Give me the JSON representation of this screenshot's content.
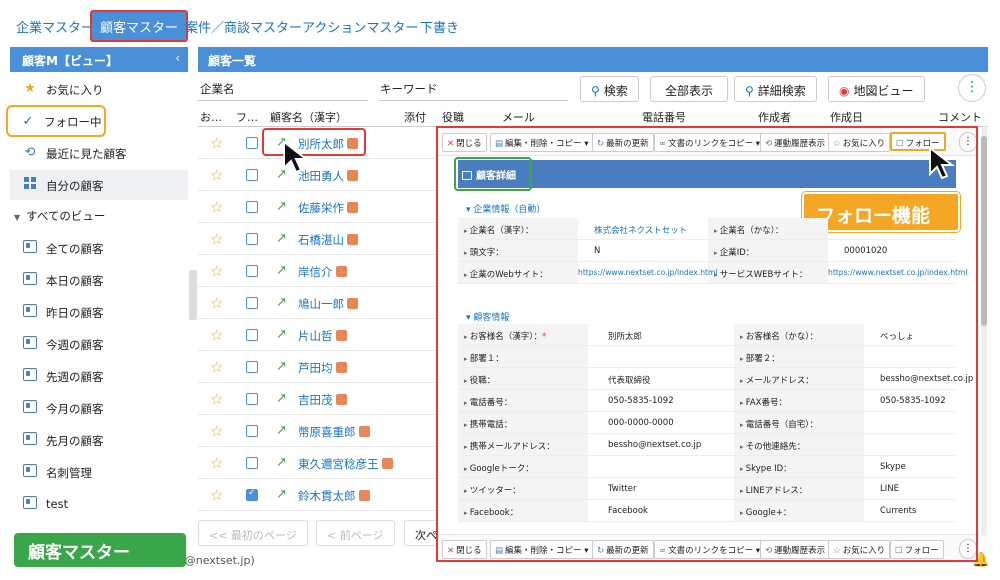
{
  "top_tabs": [
    "企業マスター",
    "顧客マスター",
    "案件／商談マスター",
    "アクションマスター",
    "下書き"
  ],
  "sidebar": {
    "title": "顧客M【ビュー】",
    "collapse_icon": "chevron-left-icon",
    "items": [
      {
        "label": "お気に入り",
        "icon": "star-icon"
      },
      {
        "label": "フォロー中",
        "icon": "check-icon"
      },
      {
        "label": "最近に見た顧客",
        "icon": "history-icon"
      },
      {
        "label": "自分の顧客",
        "icon": "grid-icon"
      }
    ],
    "group_label": "すべてのビュー",
    "views": [
      "全ての顧客",
      "本日の顧客",
      "昨日の顧客",
      "今週の顧客",
      "先週の顧客",
      "今月の顧客",
      "先月の顧客",
      "名刺管理",
      "test"
    ]
  },
  "main": {
    "title": "顧客一覧",
    "filters": {
      "company": "企業名",
      "keyword": "キーワード"
    },
    "buttons": {
      "search": "検索",
      "show_all": "全部表示",
      "advanced": "詳細検索",
      "map": "地図ビュー"
    },
    "columns": [
      "お…",
      "フ…",
      "顧客名（漢字）",
      "添付",
      "役職",
      "メール",
      "電話番号",
      "作成者",
      "作成日",
      "コメント"
    ],
    "rows": [
      {
        "name": "別所太郎",
        "follow": false
      },
      {
        "name": "池田勇人",
        "follow": false
      },
      {
        "name": "佐藤栄作",
        "follow": false
      },
      {
        "name": "石橋湛山",
        "follow": false
      },
      {
        "name": "岸信介",
        "follow": false
      },
      {
        "name": "鳩山一郎",
        "follow": false
      },
      {
        "name": "片山哲",
        "follow": false
      },
      {
        "name": "芦田均",
        "follow": false
      },
      {
        "name": "吉田茂",
        "follow": false
      },
      {
        "name": "幣原喜重郎",
        "follow": false
      },
      {
        "name": "東久邇宮稔彦王",
        "follow": false
      },
      {
        "name": "鈴木貫太郎",
        "follow": true
      }
    ],
    "pager": {
      "first": "<< 最初のページ",
      "prev": "< 前ページ",
      "next": "次ペ"
    },
    "footer_email": "a@nextset.jp)"
  },
  "detail": {
    "toolbar": {
      "close": "閉じる",
      "edit": "編集・削除・コピー",
      "refresh": "最新の更新",
      "copy_link": "文書のリンクをコピー",
      "history": "運動履歴表示",
      "favorite": "お気に入り",
      "follow": "フォロー"
    },
    "header": "顧客詳細",
    "section1": {
      "title": "企業情報（自動）",
      "fields": [
        {
          "l1": "企業名（漢字）：",
          "v1": "株式会社ネクストセット",
          "l2": "企業名（かな）：",
          "v2": ""
        },
        {
          "l1": "頭文字：",
          "v1": "N",
          "l2": "企業ID：",
          "v2": "00001020"
        },
        {
          "l1": "企業のWebサイト：",
          "v1": "https://www.nextset.co.jp/index.html",
          "l2": "サービスWEBサイト：",
          "v2": "https://www.nextset.co.jp/index.html"
        }
      ]
    },
    "section2": {
      "title": "顧客情報",
      "fields": [
        {
          "l1": "お客様名（漢字）：",
          "v1": "別所太郎",
          "l2": "お客様名（かな）：",
          "v2": "べっしょ"
        },
        {
          "l1": "部署１：",
          "v1": "",
          "l2": "部署２：",
          "v2": ""
        },
        {
          "l1": "役職：",
          "v1": "代表取締役",
          "l2": "メールアドレス：",
          "v2": "bessho@nextset.co.jp"
        },
        {
          "l1": "電話番号：",
          "v1": "050-5835-1092",
          "l2": "FAX番号：",
          "v2": "050-5835-1092"
        },
        {
          "l1": "携帯電話：",
          "v1": "000-0000-0000",
          "l2": "電話番号（自宅）：",
          "v2": ""
        },
        {
          "l1": "携帯メールアドレス：",
          "v1": "bessho@nextset.co.jp",
          "l2": "その他連絡先：",
          "v2": ""
        },
        {
          "l1": "Googleトーク：",
          "v1": "",
          "l2": "Skype ID：",
          "v2": "Skype"
        },
        {
          "l1": "ツイッター：",
          "v1": "Twitter",
          "l2": "LINEアドレス：",
          "v2": "LINE"
        },
        {
          "l1": "Facebook：",
          "v1": "Facebook",
          "l2": "Google+：",
          "v2": "Currents"
        }
      ]
    }
  },
  "annotations": {
    "follow_feature": "フォロー機能",
    "customer_master": "顧客マスター"
  },
  "colors": {
    "accent": "#4a90d9",
    "highlight_red": "#e53935",
    "highlight_orange": "#f5a623",
    "highlight_green": "#3aa64a"
  }
}
